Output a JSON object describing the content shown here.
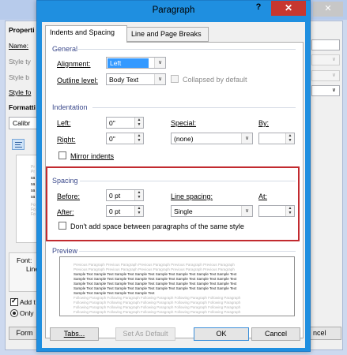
{
  "background_window": {
    "close_glyph": "✕",
    "labels": {
      "properties": "Properti",
      "name": "Name:",
      "style_type": "Style ty",
      "style_based": "Style b",
      "style_following": "Style fo",
      "formatting": "Formatti",
      "font_value": "Calibr",
      "font_desc": "Font:",
      "line_desc": "Line",
      "add_to": "Add t",
      "only": "Only",
      "format_button": "Form",
      "cancel_button": "ncel"
    },
    "preview_lines": [
      "Pr",
      "Pr",
      "sa",
      "sa",
      "sa",
      "sa",
      "Fo",
      "Fo",
      "Fo"
    ]
  },
  "dialog": {
    "title": "Paragraph",
    "help_glyph": "?",
    "close_glyph": "✕",
    "tabs": [
      {
        "label": "Indents and Spacing",
        "active": true
      },
      {
        "label": "Line and Page Breaks",
        "active": false
      }
    ],
    "general": {
      "title": "General",
      "alignment_label": "Alignment:",
      "alignment_value": "Left",
      "outline_label": "Outline level:",
      "outline_value": "Body Text",
      "collapsed_label": "Collapsed by default",
      "collapsed_checked": false
    },
    "indentation": {
      "title": "Indentation",
      "left_label": "Left:",
      "left_value": "0\"",
      "right_label": "Right:",
      "right_value": "0\"",
      "special_label": "Special:",
      "special_value": "(none)",
      "by_label": "By:",
      "by_value": "",
      "mirror_label": "Mirror indents",
      "mirror_checked": false
    },
    "spacing": {
      "title": "Spacing",
      "before_label": "Before:",
      "before_value": "0 pt",
      "after_label": "After:",
      "after_value": "0 pt",
      "line_spacing_label": "Line spacing:",
      "line_spacing_value": "Single",
      "at_label": "At:",
      "at_value": "",
      "dont_add_label": "Don't add space between paragraphs of the same style",
      "dont_add_checked": false
    },
    "preview": {
      "title": "Preview",
      "lines": [
        {
          "tone": "grey",
          "text": "Previous Paragraph Previous Paragraph Previous Paragraph Previous Paragraph Previous Paragraph"
        },
        {
          "tone": "grey",
          "text": "Previous Paragraph Previous Paragraph Previous Paragraph Previous Paragraph Previous Paragraph"
        },
        {
          "tone": "dark",
          "text": "Sample Text Sample Text Sample Text Sample Text Sample Text Sample Text Sample Text Sample Text"
        },
        {
          "tone": "dark",
          "text": "Sample Text Sample Text Sample Text Sample Text Sample Text Sample Text Sample Text Sample Text"
        },
        {
          "tone": "dark",
          "text": "Sample Text Sample Text Sample Text Sample Text Sample Text Sample Text Sample Text Sample Text"
        },
        {
          "tone": "dark",
          "text": "Sample Text Sample Text Sample Text Sample Text Sample Text Sample Text Sample Text Sample Text"
        },
        {
          "tone": "dark",
          "text": "Sample Text Sample Text Sample Text Sample Text"
        },
        {
          "tone": "grey",
          "text": "Following Paragraph Following Paragraph Following Paragraph Following Paragraph Following Paragraph"
        },
        {
          "tone": "grey",
          "text": "Following Paragraph Following Paragraph Following Paragraph Following Paragraph Following Paragraph"
        },
        {
          "tone": "grey",
          "text": "Following Paragraph Following Paragraph Following Paragraph Following Paragraph Following Paragraph"
        },
        {
          "tone": "grey",
          "text": "Following Paragraph Following Paragraph Following Paragraph Following Paragraph Following Paragraph"
        }
      ]
    },
    "buttons": {
      "tabs": "Tabs...",
      "set_default": "Set As Default",
      "ok": "OK",
      "cancel": "Cancel"
    },
    "colors": {
      "title_bar": "#1f8fe0",
      "close_button": "#c7372f",
      "highlight_border": "#c22a2f",
      "section_title": "#3c4a8c",
      "selection": "#3399ff"
    },
    "icons": {
      "dropdown": "chevron-down-icon",
      "spin": "spin-arrows-icon",
      "close": "close-icon",
      "help": "help-icon"
    }
  }
}
